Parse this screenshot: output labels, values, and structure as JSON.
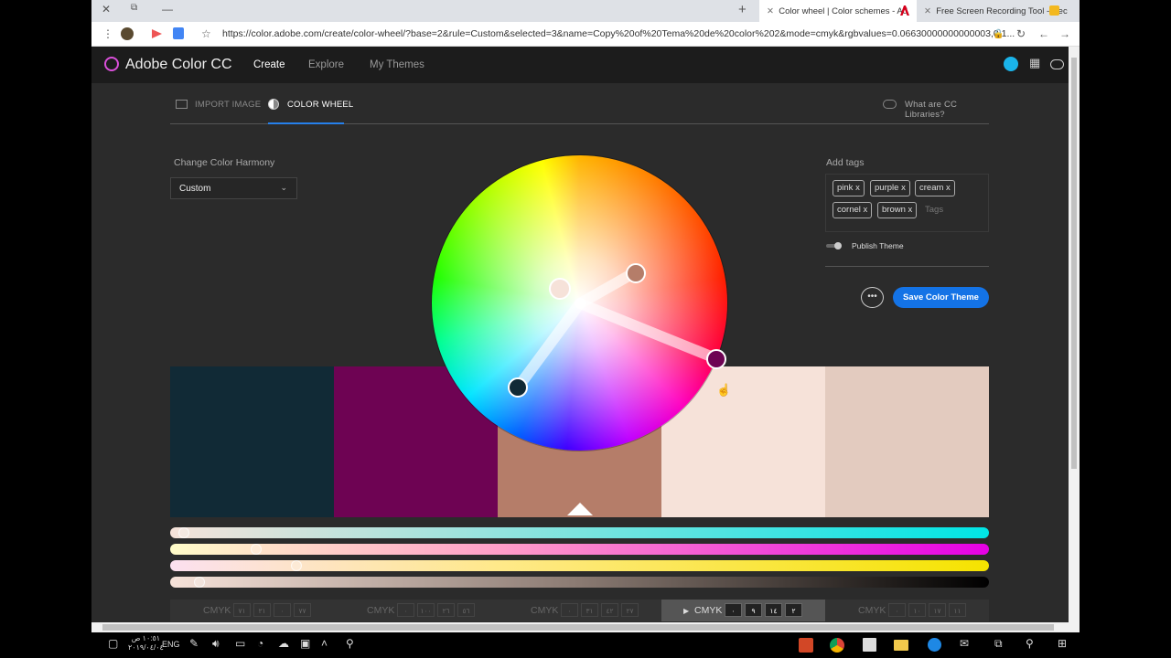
{
  "browser": {
    "window_controls": [
      "✕",
      "⧉",
      "—"
    ],
    "new_tab": "+",
    "tabs": [
      {
        "title": "Color wheel | Color schemes - Ad",
        "active": true
      },
      {
        "title": "Free Screen Recording Tool - Rec",
        "active": false
      }
    ],
    "url": "https://color.adobe.com/create/color-wheel/?base=2&rule=Custom&selected=3&name=Copy%20of%20Tema%20de%20color%202&mode=cmyk&rgbvalues=0.06630000000000003,0.1..."
  },
  "app": {
    "brand": "Adobe Color CC",
    "nav": [
      {
        "label": "Create",
        "active": true
      },
      {
        "label": "Explore",
        "active": false
      },
      {
        "label": "My Themes",
        "active": false
      }
    ]
  },
  "subtabs": {
    "import_image": "IMPORT IMAGE",
    "color_wheel": "COLOR WHEEL",
    "cc_libraries": "What are CC Libraries?"
  },
  "harmony": {
    "label": "Change Color Harmony",
    "value": "Custom"
  },
  "tags": {
    "label": "Add tags",
    "items": [
      "pink",
      "purple",
      "cream",
      "cornel",
      "brown"
    ],
    "placeholder": "Tags",
    "publish_label": "Publish Theme",
    "remove_glyph": "x"
  },
  "actions": {
    "more": "•••",
    "save": "Save Color Theme"
  },
  "swatches": [
    {
      "color": "#112a36"
    },
    {
      "color": "#6e0353"
    },
    {
      "color": "#b57d69"
    },
    {
      "color": "#f6e2d9"
    },
    {
      "color": "#e3cbbf"
    }
  ],
  "selected_swatch": 3,
  "sliders": [
    {
      "gradient": "linear-gradient(90deg,#f6e2d9,#00e5e5)",
      "value_fraction": 0.01
    },
    {
      "gradient": "linear-gradient(90deg,#fffcc8,#ff9ec8 40%,#e600e5)",
      "value_fraction": 0.1
    },
    {
      "gradient": "linear-gradient(90deg,#fce0f0,#ffe98a 40%,#f5e300)",
      "value_fraction": 0.15
    },
    {
      "gradient": "linear-gradient(90deg,#f6e2d9,#8a7a72 50%,#000)",
      "value_fraction": 0.03
    }
  ],
  "cmyk": [
    {
      "label": "CMYK",
      "values": [
        "٧١",
        "٢١",
        "٠",
        "٧٧"
      ]
    },
    {
      "label": "CMYK",
      "values": [
        "٠",
        "١٠٠",
        "٢٦",
        "٥٦"
      ]
    },
    {
      "label": "CMYK",
      "values": [
        "٠",
        "٣١",
        "٤٢",
        "٢٧"
      ]
    },
    {
      "label": "CMYK",
      "values": [
        "٠",
        "٩",
        "١٤",
        "٢"
      ]
    },
    {
      "label": "CMYK",
      "values": [
        "٠",
        "١٠",
        "١٧",
        "١١"
      ]
    }
  ],
  "taskbar": {
    "lang": "ENG",
    "time": "١٠:٥١ ص",
    "date": "٢٠١٩/٠٤/٠٤"
  }
}
